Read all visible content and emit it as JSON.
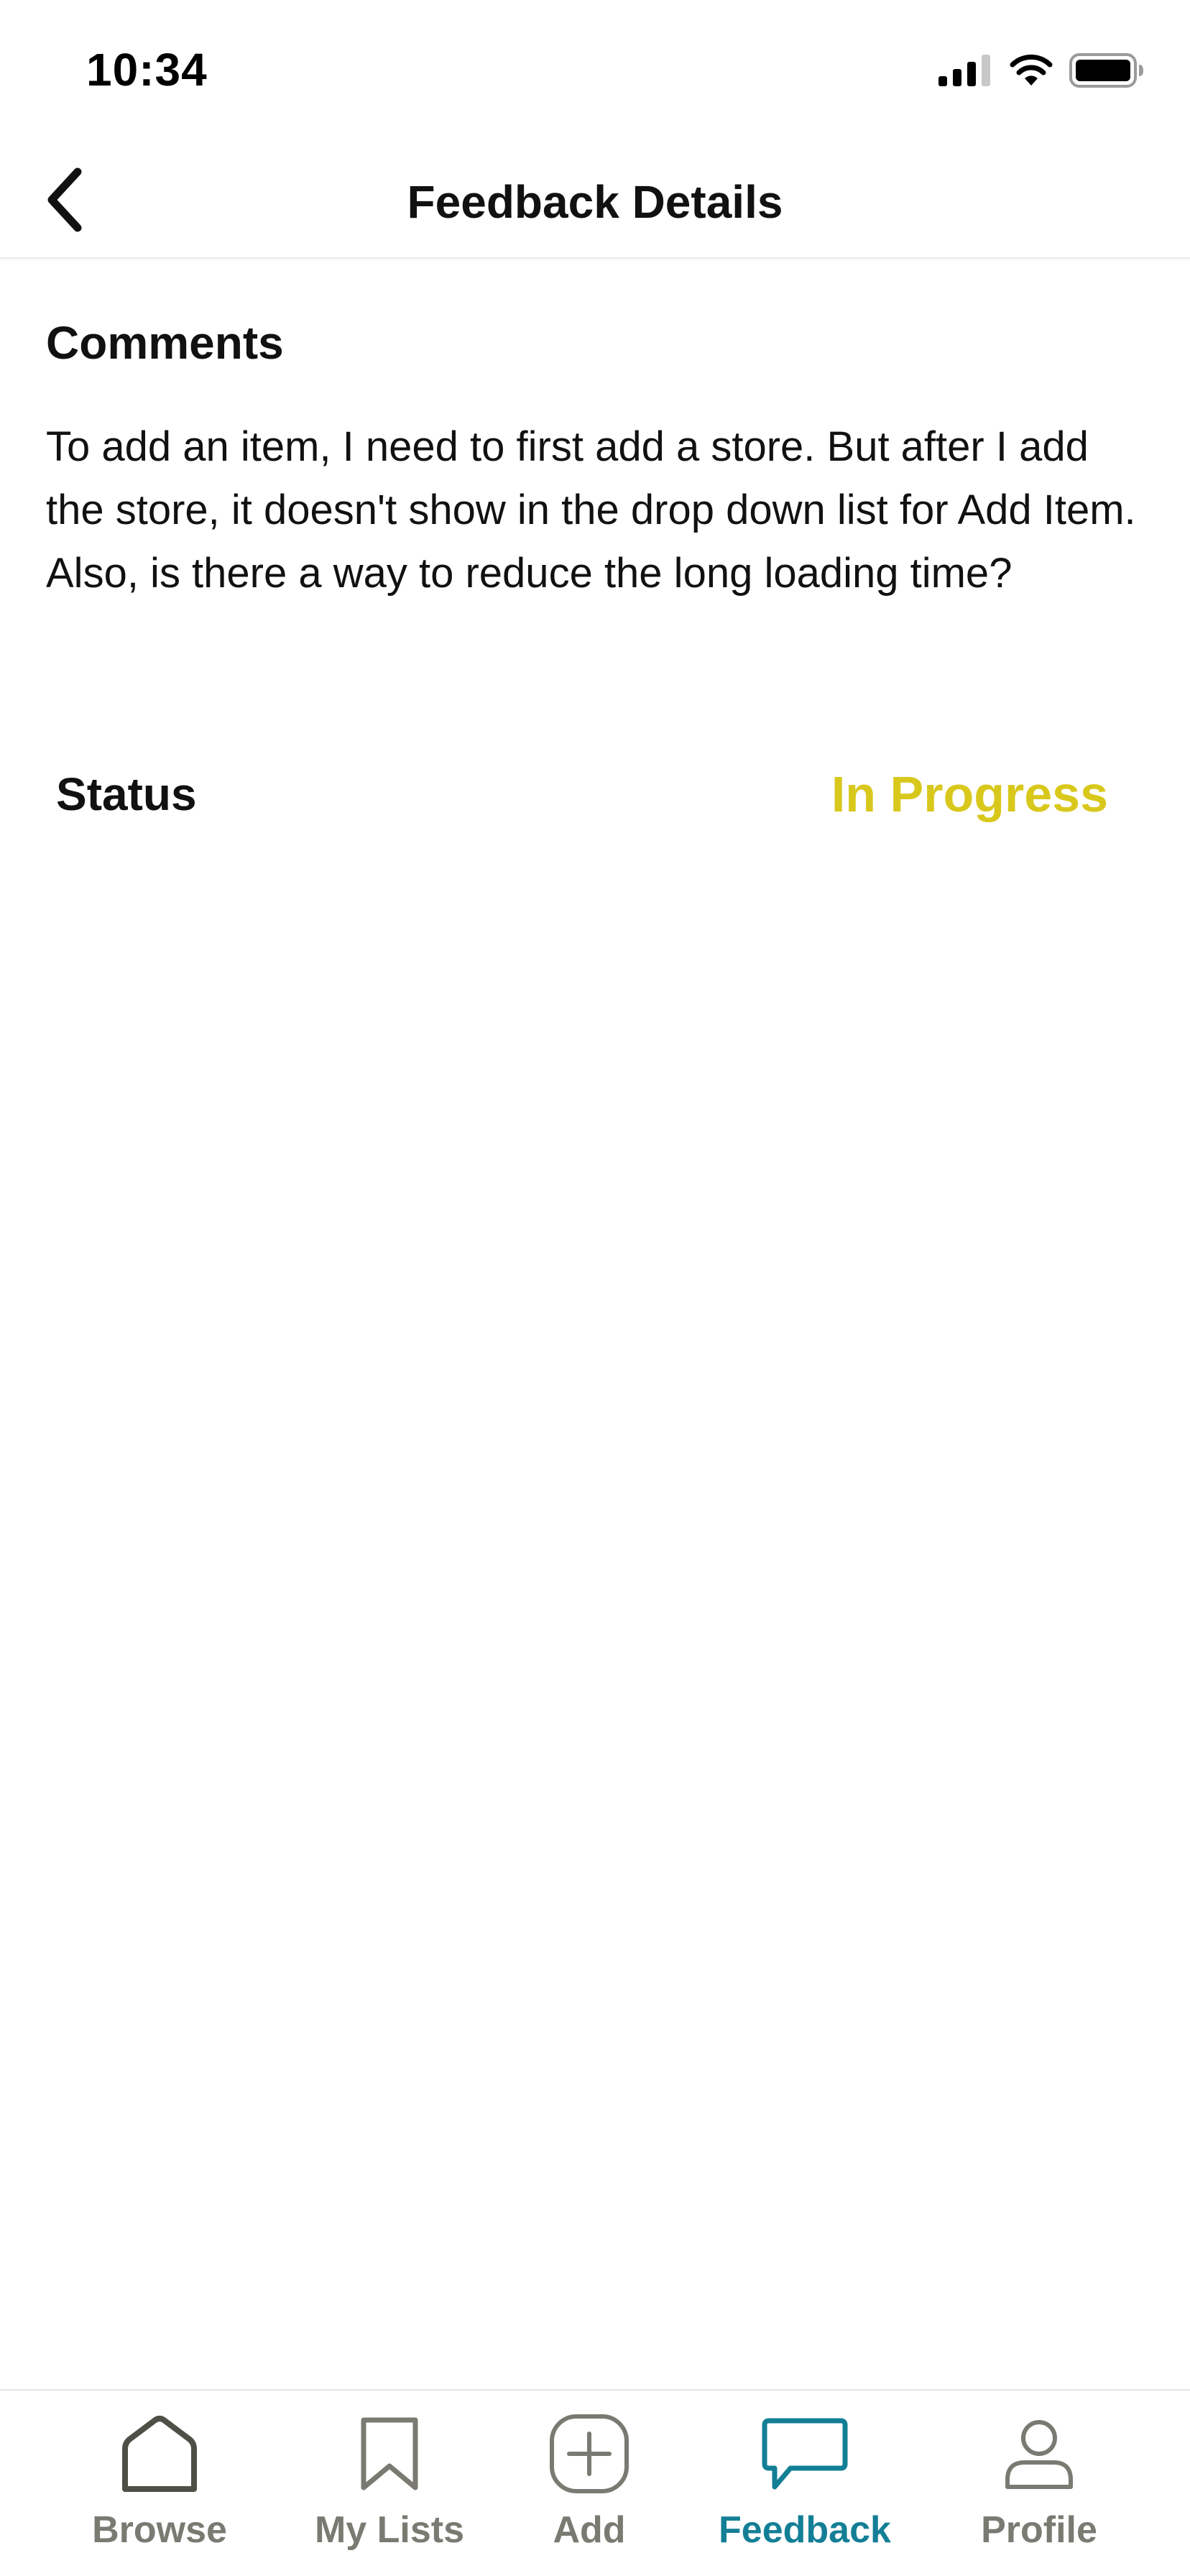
{
  "status_bar": {
    "time": "10:34"
  },
  "header": {
    "title": "Feedback Details",
    "back_icon": "chevron-left-icon"
  },
  "comments": {
    "heading": "Comments",
    "text": "To add an item, I need to first add a store. But after I add the store, it doesn't show in the drop down list for Add Item. Also, is there a way to reduce the long loading time?"
  },
  "status": {
    "label": "Status",
    "value": "In Progress",
    "value_color": "#d9c81c"
  },
  "tab_bar": {
    "active_color": "#137f96",
    "inactive_color": "#7a7a72",
    "tabs": [
      {
        "label": "Browse",
        "icon": "home-icon",
        "active": false
      },
      {
        "label": "My Lists",
        "icon": "bookmark-icon",
        "active": false
      },
      {
        "label": "Add",
        "icon": "plus-square-icon",
        "active": false
      },
      {
        "label": "Feedback",
        "icon": "chat-bubble-icon",
        "active": true
      },
      {
        "label": "Profile",
        "icon": "user-icon",
        "active": false
      }
    ]
  }
}
